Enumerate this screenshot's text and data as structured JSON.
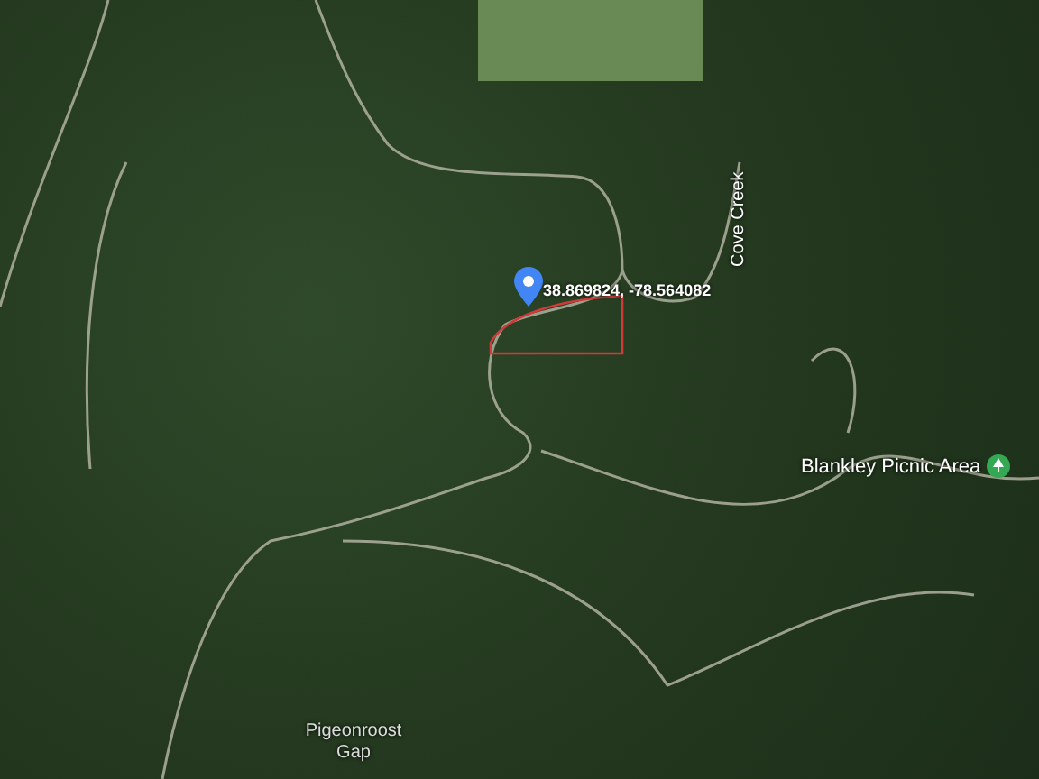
{
  "map": {
    "pin_label": "38.869824, -78.564082",
    "labels": [
      {
        "kind": "road",
        "text": "Cove Creek"
      },
      {
        "kind": "poi",
        "text": "Blankley Picnic Area"
      },
      {
        "kind": "place",
        "text": "Pigeonroost Gap"
      }
    ]
  }
}
